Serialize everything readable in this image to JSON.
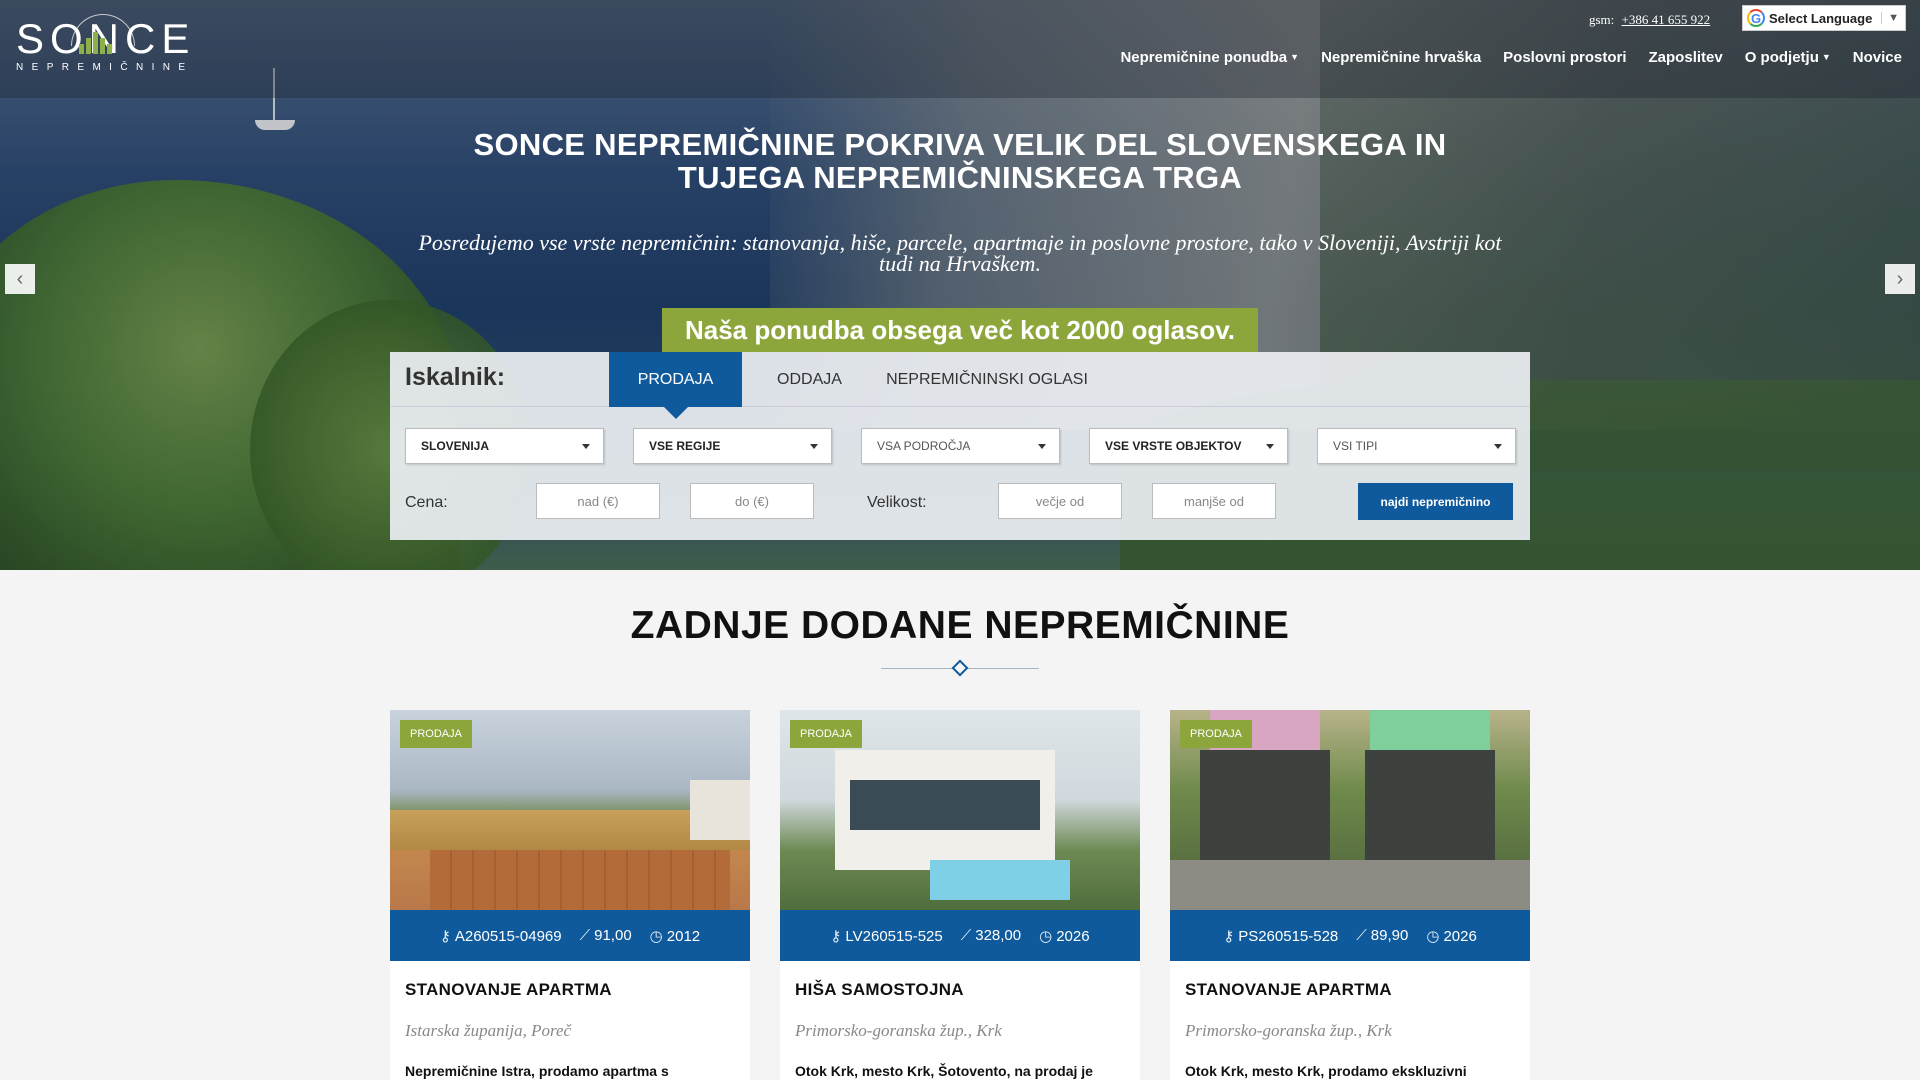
{
  "brand": {
    "logo_word": "SONCE",
    "logo_sub": "NEPREMIČNINE"
  },
  "header": {
    "gsm_label": "gsm:",
    "gsm_number": "+386 41 655 922",
    "language_label": "Select Language",
    "nav": [
      {
        "label": "Nepremičnine ponudba",
        "dropdown": true
      },
      {
        "label": "Nepremičnine hrvaška",
        "dropdown": false
      },
      {
        "label": "Poslovni prostori",
        "dropdown": false
      },
      {
        "label": "Zaposlitev",
        "dropdown": false
      },
      {
        "label": "O podjetju",
        "dropdown": true
      },
      {
        "label": "Novice",
        "dropdown": false
      }
    ]
  },
  "hero": {
    "title_line1": "SONCE NEPREMIČNINE POKRIVA VELIK DEL SLOVENSKEGA IN",
    "title_line2": "TUJEGA NEPREMIČNINSKEGA TRGA",
    "subtitle_line1": "Posredujemo vse vrste nepremičnin: stanovanja, hiše, parcele, apartmaje in poslovne prostore, tako v Sloveniji, Avstriji kot",
    "subtitle_line2": "tudi na Hrvaškem.",
    "offer": "Naša ponudba obsega več kot 2000 oglasov."
  },
  "search": {
    "label": "Iskalnik:",
    "tabs": [
      "PRODAJA",
      "ODDAJA",
      "NEPREMIČNINSKI OGLASI"
    ],
    "active_tab": "PRODAJA",
    "selects": [
      "SLOVENIJA",
      "VSE REGIJE",
      "VSA PODROČJA",
      "VSE VRSTE OBJEKTOV",
      "VSI TIPI"
    ],
    "price_label": "Cena:",
    "price_from": "nad (€)",
    "price_to": "do (€)",
    "size_label": "Velikost:",
    "size_from": "večje od",
    "size_to": "manjše od",
    "submit": "najdi nepremičnino"
  },
  "section": {
    "title": "ZADNJE DODANE NEPREMIČNINE"
  },
  "listings": [
    {
      "badge": "PRODAJA",
      "code": "A260515-04969",
      "area": "91,00",
      "year": "2012",
      "title": "STANOVANJE APARTMA",
      "location": "Istarska županija, Poreč",
      "desc": "Nepremičnine Istra, prodamo apartma s"
    },
    {
      "badge": "PRODAJA",
      "code": "LV260515-525",
      "area": "328,00",
      "year": "2026",
      "title": "HIŠA SAMOSTOJNA",
      "location": "Primorsko-goranska žup., Krk",
      "desc": "Otok Krk, mesto Krk, Šotovento, na prodaj je"
    },
    {
      "badge": "PRODAJA",
      "code": "PS260515-528",
      "area": "89,90",
      "year": "2026",
      "title": "STANOVANJE APARTMA",
      "location": "Primorsko-goranska žup., Krk",
      "desc": "Otok Krk, mesto Krk, prodamo ekskluzivni"
    }
  ],
  "colors": {
    "primary": "#0f5a9c",
    "accent": "#8da63c"
  }
}
